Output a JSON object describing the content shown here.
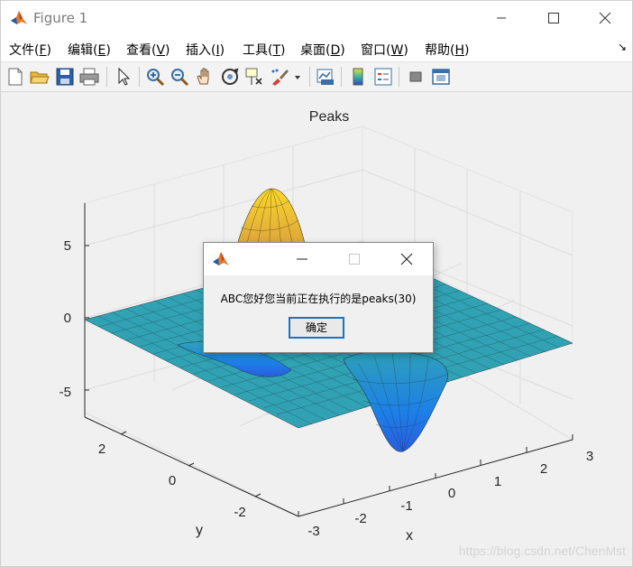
{
  "window": {
    "title": "Figure 1"
  },
  "menu": [
    {
      "label": "文件(",
      "key": "F",
      "end": ")"
    },
    {
      "label": "编辑(",
      "key": "E",
      "end": ")"
    },
    {
      "label": "查看(",
      "key": "V",
      "end": ")"
    },
    {
      "label": "插入(",
      "key": "I",
      "end": ")"
    },
    {
      "label": "工具(",
      "key": "T",
      "end": ")"
    },
    {
      "label": "桌面(",
      "key": "D",
      "end": ")"
    },
    {
      "label": "窗口(",
      "key": "W",
      "end": ")"
    },
    {
      "label": "帮助(",
      "key": "H",
      "end": ")"
    }
  ],
  "toolbar": [
    "new-figure-icon",
    "open-file-icon",
    "save-icon",
    "print-icon",
    "select-arrow-icon",
    "zoom-in-icon",
    "zoom-out-icon",
    "pan-hand-icon",
    "rotate-3d-icon",
    "data-cursor-icon",
    "brush-icon",
    "link-plot-icon",
    "colorbar-icon",
    "legend-icon",
    "hide-plot-tools-icon",
    "show-plot-tools-icon"
  ],
  "plot": {
    "title": "Peaks",
    "z_ticks": [
      "5",
      "0",
      "-5"
    ],
    "y_ticks": [
      "2",
      "0",
      "-2"
    ],
    "x_ticks": [
      "-3",
      "-2",
      "-1",
      "0",
      "1",
      "2",
      "3"
    ],
    "xlabel": "x",
    "ylabel": "y",
    "colors": {
      "high": "#f9d82a",
      "mid": "#3ab7a0",
      "low": "#1f6fe8",
      "base": "#31a2b4"
    }
  },
  "dialog": {
    "message": "ABC您好您当前正在执行的是peaks(30)",
    "ok_label": "确定"
  },
  "watermark": "https://blog.csdn.net/ChenMst"
}
